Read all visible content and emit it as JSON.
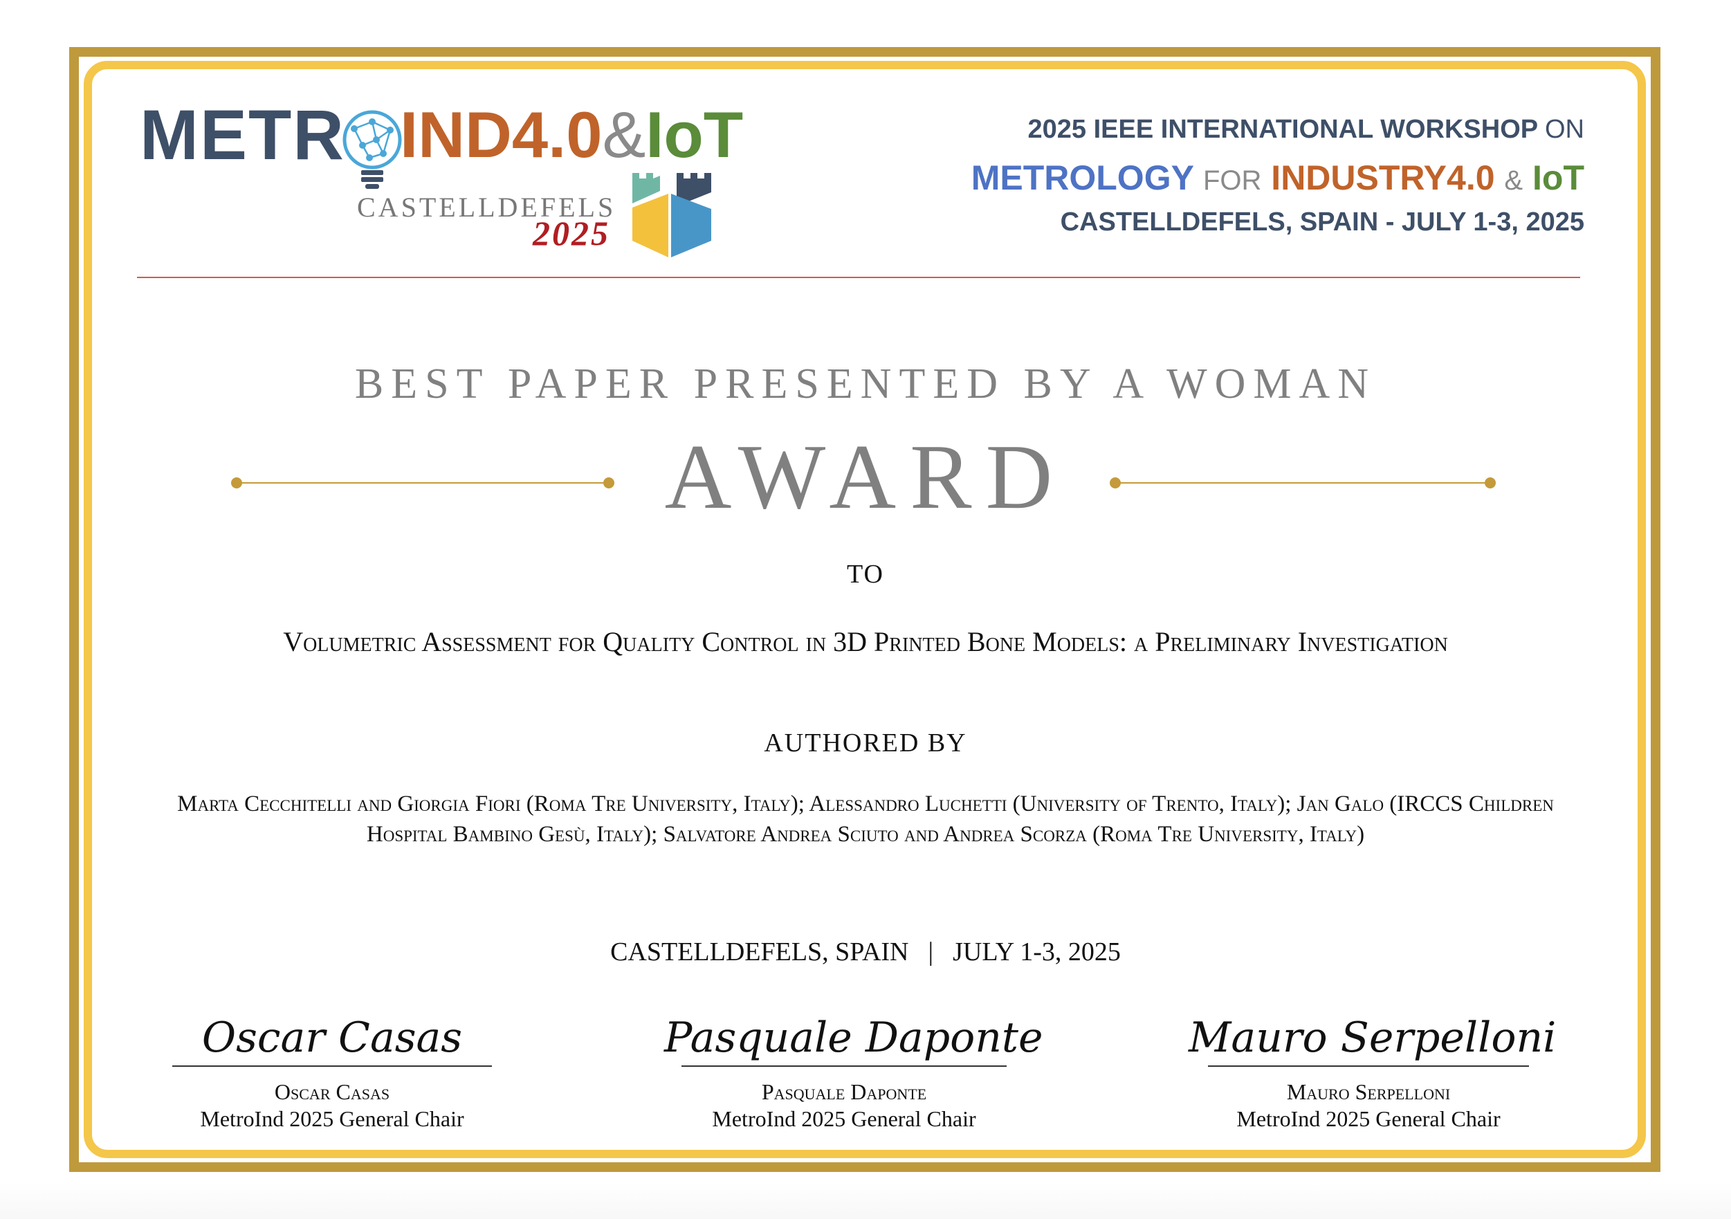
{
  "logo": {
    "metro": "METR",
    "ind": "IND4.0",
    "amp": "&",
    "iot": "IoT",
    "city": "CASTELLDEFELS",
    "year": "2025",
    "colors": {
      "navy": "#3e4f68",
      "orange": "#c0632a",
      "blue": "#4e73c4",
      "green": "#5a8c3a",
      "red": "#b01e23",
      "castle_yellow": "#f4c13d",
      "castle_blue": "#4896c8"
    }
  },
  "header": {
    "line1_main": "2025 IEEE INTERNATIONAL WORKSHOP",
    "line1_on": "ON",
    "metrology": "METROLOGY",
    "for": "FOR",
    "industry": "INDUSTRY4.0",
    "amp": "&",
    "iot": "IoT",
    "line3": "CASTELLDEFELS, SPAIN - JULY 1-3, 2025"
  },
  "award": {
    "category": "BEST PAPER PRESENTED BY A WOMAN",
    "word": "AWARD",
    "to": "TO",
    "paper_title": "Volumetric Assessment for Quality Control in 3D Printed Bone Models: a Preliminary Investigation",
    "authored_by": "AUTHORED BY",
    "authors": "Marta Cecchitelli and Giorgia Fiori (Roma Tre University, Italy); Alessandro Luchetti (University of Trento, Italy); Jan Galo (IRCCS Children Hospital Bambino Gesù, Italy); Salvatore Andrea Sciuto and Andrea Scorza (Roma Tre University, Italy)",
    "location": "CASTELLDEFELS, SPAIN",
    "separator": "|",
    "dates": "JULY 1-3, 2025"
  },
  "signatures": [
    {
      "signature": "Oscar Casas",
      "name": "Oscar Casas",
      "role": "MetroInd 2025 General Chair"
    },
    {
      "signature": "Pasquale Daponte",
      "name": "Pasquale Daponte",
      "role": "MetroInd 2025 General Chair"
    },
    {
      "signature": "Mauro Serpelloni",
      "name": "Mauro Serpelloni",
      "role": "MetroInd 2025 General Chair"
    }
  ],
  "frame_colors": {
    "outer": "#bf9a3c",
    "inner": "#f4c64a",
    "divider": "#d05c55",
    "ornament": "#c49a3a"
  }
}
